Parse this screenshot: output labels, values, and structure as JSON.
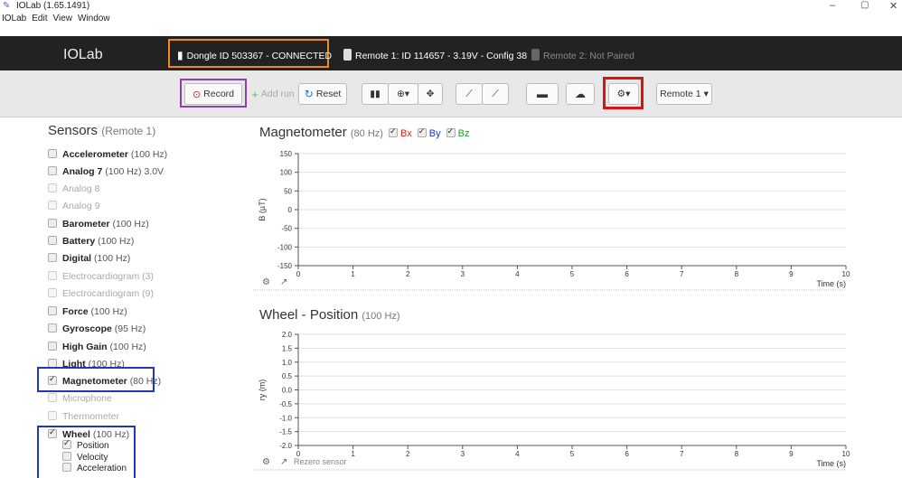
{
  "window": {
    "title": "IOLab (1.65.1491)",
    "menu": [
      "IOLab",
      "Edit",
      "View",
      "Window"
    ],
    "controls": [
      "–",
      "▢",
      "✕"
    ]
  },
  "header": {
    "brand": "IOLab",
    "dongle": "Dongle ID 503367 - CONNECTED",
    "remote1": "Remote 1: ID 114657 - 3.19V - Config 38",
    "remote2": "Remote 2: Not Paired"
  },
  "toolbar": {
    "record": "Record",
    "add_run": "Add run",
    "reset": "Reset",
    "remote_select": "Remote 1"
  },
  "sidebar": {
    "title": "Sensors",
    "subtitle": "(Remote 1)",
    "sensors": [
      {
        "name": "Accelerometer",
        "rate": "(100 Hz)",
        "enabled": true,
        "checked": false
      },
      {
        "name": "Analog 7",
        "rate": "(100 Hz) 3.0V",
        "enabled": true,
        "checked": false
      },
      {
        "name": "Analog 8",
        "rate": "",
        "enabled": false,
        "checked": false
      },
      {
        "name": "Analog 9",
        "rate": "",
        "enabled": false,
        "checked": false
      },
      {
        "name": "Barometer",
        "rate": "(100 Hz)",
        "enabled": true,
        "checked": false
      },
      {
        "name": "Battery",
        "rate": "(100 Hz)",
        "enabled": true,
        "checked": false
      },
      {
        "name": "Digital",
        "rate": "(100 Hz)",
        "enabled": true,
        "checked": false
      },
      {
        "name": "Electrocardiogram (3)",
        "rate": "",
        "enabled": false,
        "checked": false
      },
      {
        "name": "Electrocardiogram (9)",
        "rate": "",
        "enabled": false,
        "checked": false
      },
      {
        "name": "Force",
        "rate": "(100 Hz)",
        "enabled": true,
        "checked": false
      },
      {
        "name": "Gyroscope",
        "rate": "(95 Hz)",
        "enabled": true,
        "checked": false
      },
      {
        "name": "High Gain",
        "rate": "(100 Hz)",
        "enabled": true,
        "checked": false
      },
      {
        "name": "Light",
        "rate": "(100 Hz)",
        "enabled": true,
        "checked": false
      },
      {
        "name": "Magnetometer",
        "rate": "(80 Hz)",
        "enabled": true,
        "checked": true
      },
      {
        "name": "Microphone",
        "rate": "",
        "enabled": false,
        "checked": false
      },
      {
        "name": "Thermometer",
        "rate": "",
        "enabled": false,
        "checked": false
      },
      {
        "name": "Wheel",
        "rate": "(100 Hz)",
        "enabled": true,
        "checked": true
      }
    ],
    "wheel_options": [
      {
        "label": "Position",
        "checked": true
      },
      {
        "label": "Velocity",
        "checked": false
      },
      {
        "label": "Acceleration",
        "checked": false
      }
    ]
  },
  "charts": [
    {
      "title": "Magnetometer",
      "rate": "(80 Hz)",
      "legend": [
        {
          "label": "Bx",
          "color": "#d62020",
          "checked": true
        },
        {
          "label": "By",
          "color": "#2233cc",
          "checked": true
        },
        {
          "label": "Bz",
          "color": "#1f9e2a",
          "checked": true
        }
      ],
      "ylabel": "B (µT)",
      "xlabel": "Time (s)",
      "yticks": [
        "150",
        "100",
        "50",
        "0",
        "-50",
        "-100",
        "-150"
      ],
      "xticks": [
        "0",
        "1",
        "2",
        "3",
        "4",
        "5",
        "6",
        "7",
        "8",
        "9",
        "10"
      ],
      "footer": ""
    },
    {
      "title": "Wheel - Position",
      "rate": "(100 Hz)",
      "legend": [],
      "ylabel": "ry (m)",
      "xlabel": "Time (s)",
      "yticks": [
        "2.0",
        "1.5",
        "1.0",
        "0.5",
        "0.0",
        "-0.5",
        "-1.0",
        "-1.5",
        "-2.0"
      ],
      "xticks": [
        "0",
        "1",
        "2",
        "3",
        "4",
        "5",
        "6",
        "7",
        "8",
        "9",
        "10"
      ],
      "footer": "Rezero sensor"
    }
  ]
}
